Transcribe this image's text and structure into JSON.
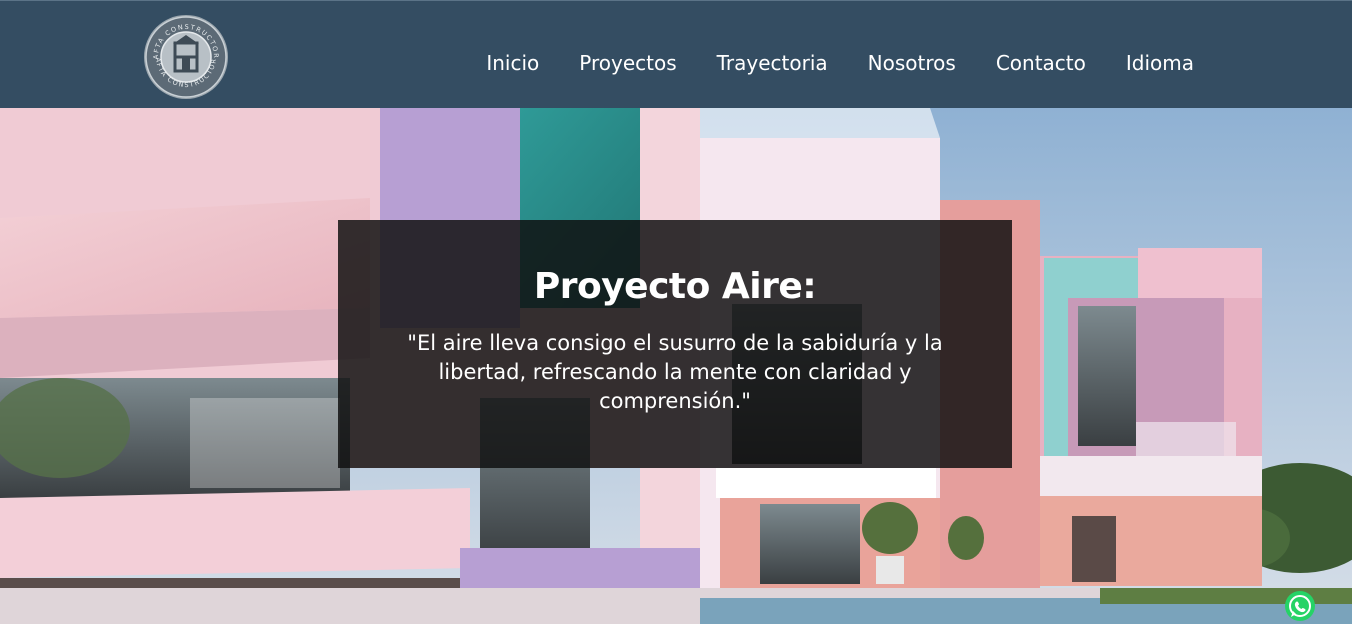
{
  "brand": {
    "logo_text": "AFTA CONSTRUCTOR",
    "logo_letter": "A"
  },
  "nav": {
    "items": [
      {
        "label": "Inicio"
      },
      {
        "label": "Proyectos"
      },
      {
        "label": "Trayectoria"
      },
      {
        "label": "Nosotros"
      },
      {
        "label": "Contacto"
      },
      {
        "label": "Idioma"
      }
    ]
  },
  "hero": {
    "title": "Proyecto Aire:",
    "quote": "\"El aire lleva consigo el susurro de la sabiduría y la libertad, refrescando la mente con claridad y comprensión.\""
  },
  "floating": {
    "whatsapp_icon": "whatsapp-icon"
  },
  "colors": {
    "navbar": "#344d62",
    "overlay": "#101010",
    "text": "#ffffff",
    "whatsapp": "#25d366"
  }
}
